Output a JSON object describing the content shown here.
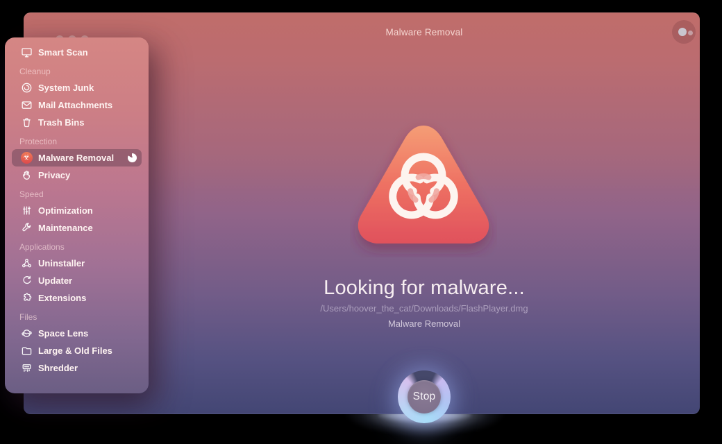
{
  "titlebar": {
    "title": "Malware Removal"
  },
  "sidebar": {
    "smart_scan": {
      "label": "Smart Scan",
      "icon": "imac-icon"
    },
    "sections": [
      {
        "label": "Cleanup",
        "items": [
          {
            "label": "System Junk",
            "icon": "cleanup-swirl-icon"
          },
          {
            "label": "Mail Attachments",
            "icon": "envelope-icon"
          },
          {
            "label": "Trash Bins",
            "icon": "trash-icon"
          }
        ]
      },
      {
        "label": "Protection",
        "items": [
          {
            "label": "Malware Removal",
            "icon": "biohazard-icon",
            "selected": true,
            "scan_in_progress": true
          },
          {
            "label": "Privacy",
            "icon": "hand-icon"
          }
        ]
      },
      {
        "label": "Speed",
        "items": [
          {
            "label": "Optimization",
            "icon": "sliders-icon"
          },
          {
            "label": "Maintenance",
            "icon": "wrench-icon"
          }
        ]
      },
      {
        "label": "Applications",
        "items": [
          {
            "label": "Uninstaller",
            "icon": "hub-icon"
          },
          {
            "label": "Updater",
            "icon": "refresh-icon"
          },
          {
            "label": "Extensions",
            "icon": "puzzle-icon"
          }
        ]
      },
      {
        "label": "Files",
        "items": [
          {
            "label": "Space Lens",
            "icon": "planet-icon"
          },
          {
            "label": "Large & Old Files",
            "icon": "folder-icon"
          },
          {
            "label": "Shredder",
            "icon": "shredder-icon"
          }
        ]
      }
    ]
  },
  "main": {
    "status_title": "Looking for malware...",
    "scan_path": "/Users/hoover_the_cat/Downloads/FlashPlayer.dmg",
    "scan_module": "Malware Removal",
    "stop_label": "Stop",
    "hero_icon": "biohazard-triangle-icon"
  },
  "colors": {
    "window_top": "#c06d6a",
    "window_bottom": "#434674",
    "sidebar_top": "#d58684",
    "sidebar_bottom": "#6b5e84",
    "accent_red": "#e4554f",
    "triangle_top": "#f59a74",
    "triangle_bottom": "#e0515c",
    "ring_lavender": "#d6c0ee",
    "ring_blue": "#a8dcf8",
    "selected_pill": "rgba(56,36,56,0.32)"
  }
}
